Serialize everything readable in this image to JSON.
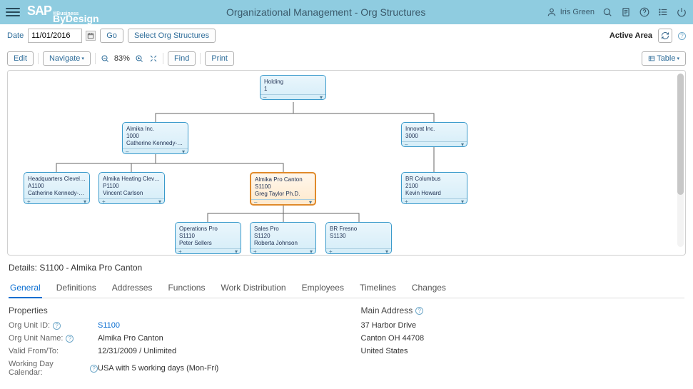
{
  "header": {
    "title": "Organizational Management - Org Structures",
    "user": "Iris Green"
  },
  "bar2": {
    "date_label": "Date",
    "date_value": "11/01/2016",
    "go_label": "Go",
    "select_label": "Select Org Structures",
    "active_area": "Active Area"
  },
  "toolbar": {
    "edit_label": "Edit",
    "navigate_label": "Navigate",
    "zoom": "83%",
    "find_label": "Find",
    "print_label": "Print",
    "table_label": "Table"
  },
  "nodes": {
    "holding": {
      "name": "Holding",
      "id": "1"
    },
    "almika_inc": {
      "name": "Almika Inc.",
      "id": "1000",
      "person": "Catherine Kennedy-Woods"
    },
    "innovat_inc": {
      "name": "Innovat Inc.",
      "id": "3000"
    },
    "hq_cleveland": {
      "name": "Headquarters Cleveland",
      "id": "A1100",
      "person": "Catherine Kennedy-Woods"
    },
    "almika_heating": {
      "name": "Almika Heating Cleveland",
      "id": "P1100",
      "person": "Vincent Carlson"
    },
    "almika_pro": {
      "name": "Almika Pro Canton",
      "id": "S1100",
      "person": "Greg Taylor Ph.D."
    },
    "br_columbus": {
      "name": "BR Columbus",
      "id": "2100",
      "person": "Kevin Howard"
    },
    "ops_pro": {
      "name": "Operations Pro",
      "id": "S1110",
      "person": "Peter Sellers"
    },
    "sales_pro": {
      "name": "Sales Pro",
      "id": "S1120",
      "person": "Roberta Johnson"
    },
    "br_fresno": {
      "name": "BR Fresno",
      "id": "S1130"
    }
  },
  "details": {
    "title": "Details: S1100 - Almika Pro Canton",
    "tabs": [
      "General",
      "Definitions",
      "Addresses",
      "Functions",
      "Work Distribution",
      "Employees",
      "Timelines",
      "Changes"
    ],
    "sections": {
      "properties": "Properties",
      "main_address": "Main Address"
    },
    "properties": {
      "org_unit_id_label": "Org Unit ID:",
      "org_unit_id": "S1100",
      "org_unit_name_label": "Org Unit Name:",
      "org_unit_name": "Almika Pro Canton",
      "valid_label": "Valid From/To:",
      "valid": "12/31/2009 / Unlimited",
      "calendar_label": "Working Day Calendar:",
      "calendar": "USA with 5 working days (Mon-Fri)"
    },
    "address": {
      "line1": "37 Harbor Drive",
      "line2": "Canton OH 44708",
      "line3": "United States"
    }
  }
}
